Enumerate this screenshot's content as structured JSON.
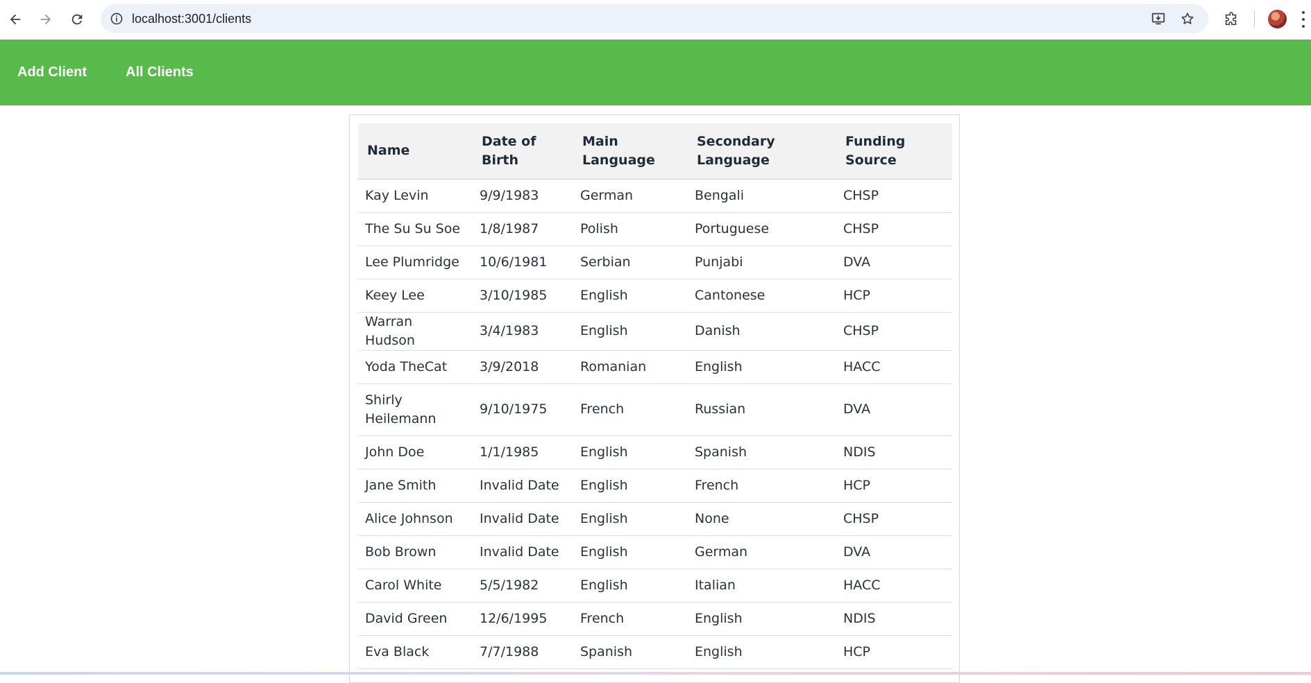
{
  "browser": {
    "url": "localhost:3001/clients"
  },
  "nav": {
    "add_client": "Add Client",
    "all_clients": "All Clients"
  },
  "table": {
    "headers": {
      "name": "Name",
      "dob": "Date of Birth",
      "main_language": "Main Language",
      "secondary_language": "Secondary Language",
      "funding_source": "Funding Source"
    },
    "rows": [
      {
        "name": "Kay Levin",
        "dob": "9/9/1983",
        "main": "German",
        "secondary": "Bengali",
        "funding": "CHSP"
      },
      {
        "name": "The Su Su Soe",
        "dob": "1/8/1987",
        "main": "Polish",
        "secondary": "Portuguese",
        "funding": "CHSP"
      },
      {
        "name": "Lee Plumridge",
        "dob": "10/6/1981",
        "main": "Serbian",
        "secondary": "Punjabi",
        "funding": "DVA"
      },
      {
        "name": "Keey Lee",
        "dob": "3/10/1985",
        "main": "English",
        "secondary": "Cantonese",
        "funding": "HCP"
      },
      {
        "name": "Warran Hudson",
        "dob": "3/4/1983",
        "main": "English",
        "secondary": "Danish",
        "funding": "CHSP"
      },
      {
        "name": "Yoda TheCat",
        "dob": "3/9/2018",
        "main": "Romanian",
        "secondary": "English",
        "funding": "HACC"
      },
      {
        "name": "Shirly Heilemann",
        "dob": "9/10/1975",
        "main": "French",
        "secondary": "Russian",
        "funding": "DVA"
      },
      {
        "name": "John Doe",
        "dob": "1/1/1985",
        "main": "English",
        "secondary": "Spanish",
        "funding": "NDIS"
      },
      {
        "name": "Jane Smith",
        "dob": "Invalid Date",
        "main": "English",
        "secondary": "French",
        "funding": "HCP"
      },
      {
        "name": "Alice Johnson",
        "dob": "Invalid Date",
        "main": "English",
        "secondary": "None",
        "funding": "CHSP"
      },
      {
        "name": "Bob Brown",
        "dob": "Invalid Date",
        "main": "English",
        "secondary": "German",
        "funding": "DVA"
      },
      {
        "name": "Carol White",
        "dob": "5/5/1982",
        "main": "English",
        "secondary": "Italian",
        "funding": "HACC"
      },
      {
        "name": "David Green",
        "dob": "12/6/1995",
        "main": "French",
        "secondary": "English",
        "funding": "NDIS"
      },
      {
        "name": "Eva Black",
        "dob": "7/7/1988",
        "main": "Spanish",
        "secondary": "English",
        "funding": "HCP"
      }
    ]
  },
  "colors": {
    "navbar": "#57ba4a",
    "header_row": "#f2f2f2",
    "omnibox": "#edf2fa"
  },
  "icons": [
    "back-icon",
    "forward-icon",
    "reload-icon",
    "site-info-icon",
    "install-app-icon",
    "bookmark-star-icon",
    "extensions-icon",
    "profile-avatar",
    "browser-menu-icon"
  ]
}
